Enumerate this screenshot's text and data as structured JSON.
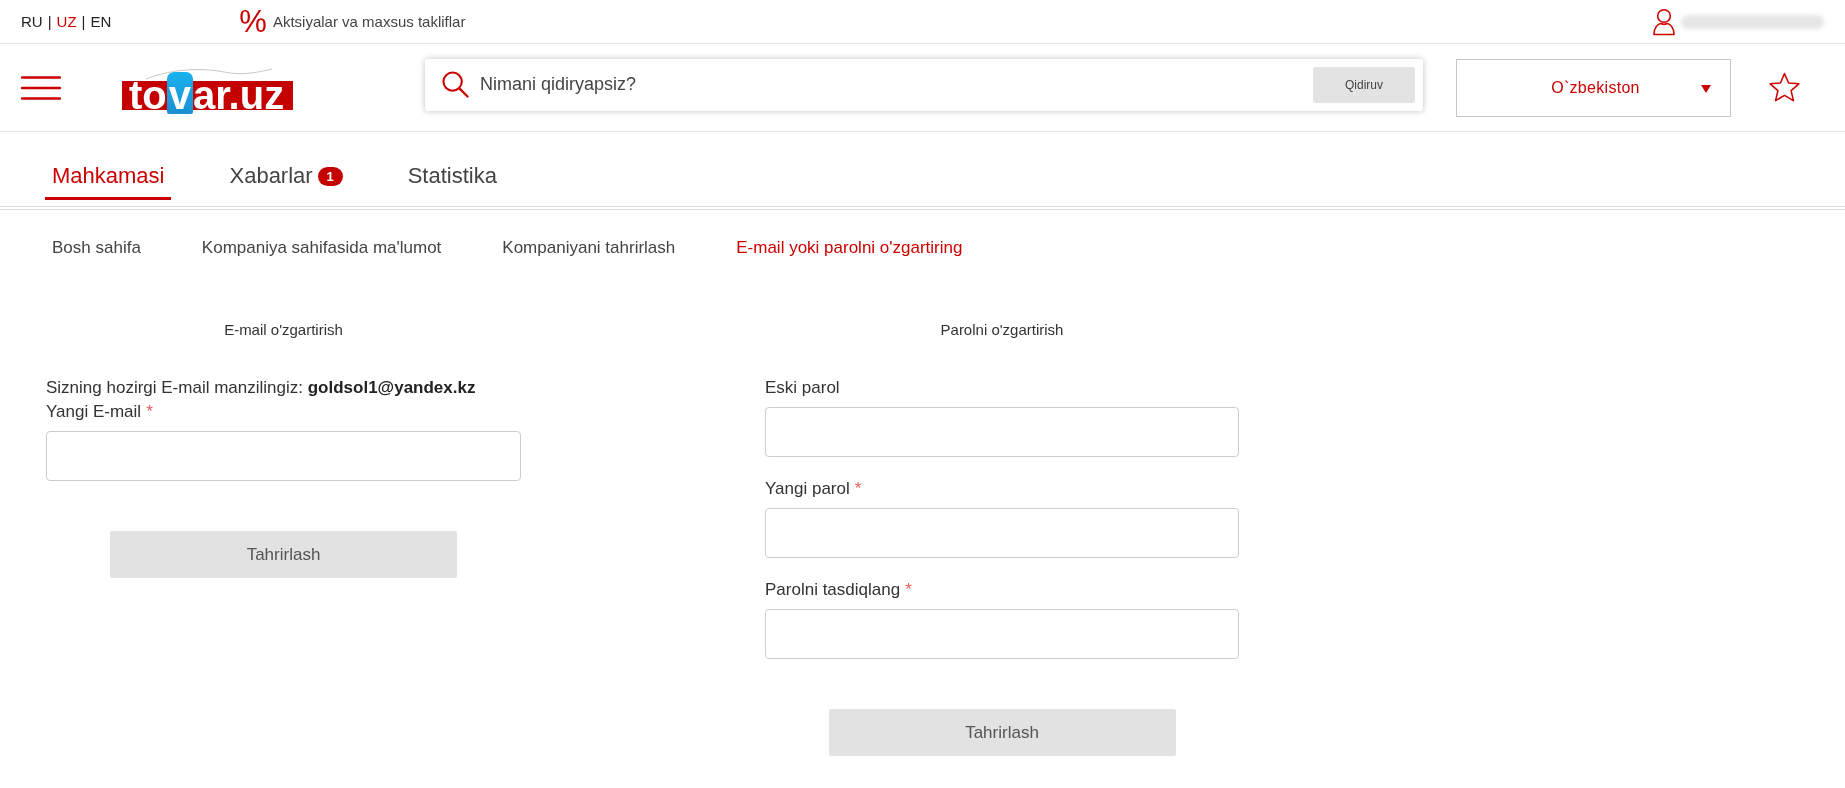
{
  "top_bar": {
    "languages": [
      {
        "label": "RU",
        "selected": false
      },
      {
        "label": "UZ",
        "selected": true
      },
      {
        "label": "EN",
        "selected": false
      }
    ],
    "separator": "|",
    "promo_sign": "%",
    "promo": "Aktsiyalar va maxsus takliflar"
  },
  "header": {
    "logo": {
      "before": "to",
      "tag": "v",
      "after": "ar.uz"
    },
    "search": {
      "placeholder": "Nimani qidiryapsiz?",
      "button": "Qidiruv"
    },
    "region": "O`zbekiston"
  },
  "tabs": [
    {
      "label": "Mahkamasi",
      "selected": true
    },
    {
      "label": "Xabarlar",
      "badge": "1",
      "selected": false
    },
    {
      "label": "Statistika",
      "selected": false
    }
  ],
  "subnav": [
    {
      "label": "Bosh sahifa",
      "selected": false
    },
    {
      "label": "Kompaniya sahifasida ma'lumot",
      "selected": false
    },
    {
      "label": "Kompaniyani tahrirlash",
      "selected": false
    },
    {
      "label": "E-mail yoki parolni o'zgartiring",
      "selected": true
    }
  ],
  "email_form": {
    "title": "E-mail o'zgartirish",
    "current": "Sizning hozirgi E-mail manzilingiz: **goldsol1@yandex.kz**",
    "fields": [
      {
        "label": "Yangi E-mail",
        "required_mark": "*"
      }
    ],
    "button": "Tahrirlash"
  },
  "password_form": {
    "title": "Parolni o'zgartirish",
    "fields": [
      {
        "label": "Eski parol"
      },
      {
        "label": "Yangi parol",
        "required_mark": "*"
      },
      {
        "label": "Parolni tasdiqlang",
        "required_mark": "*"
      }
    ],
    "button": "Tahrirlash"
  }
}
